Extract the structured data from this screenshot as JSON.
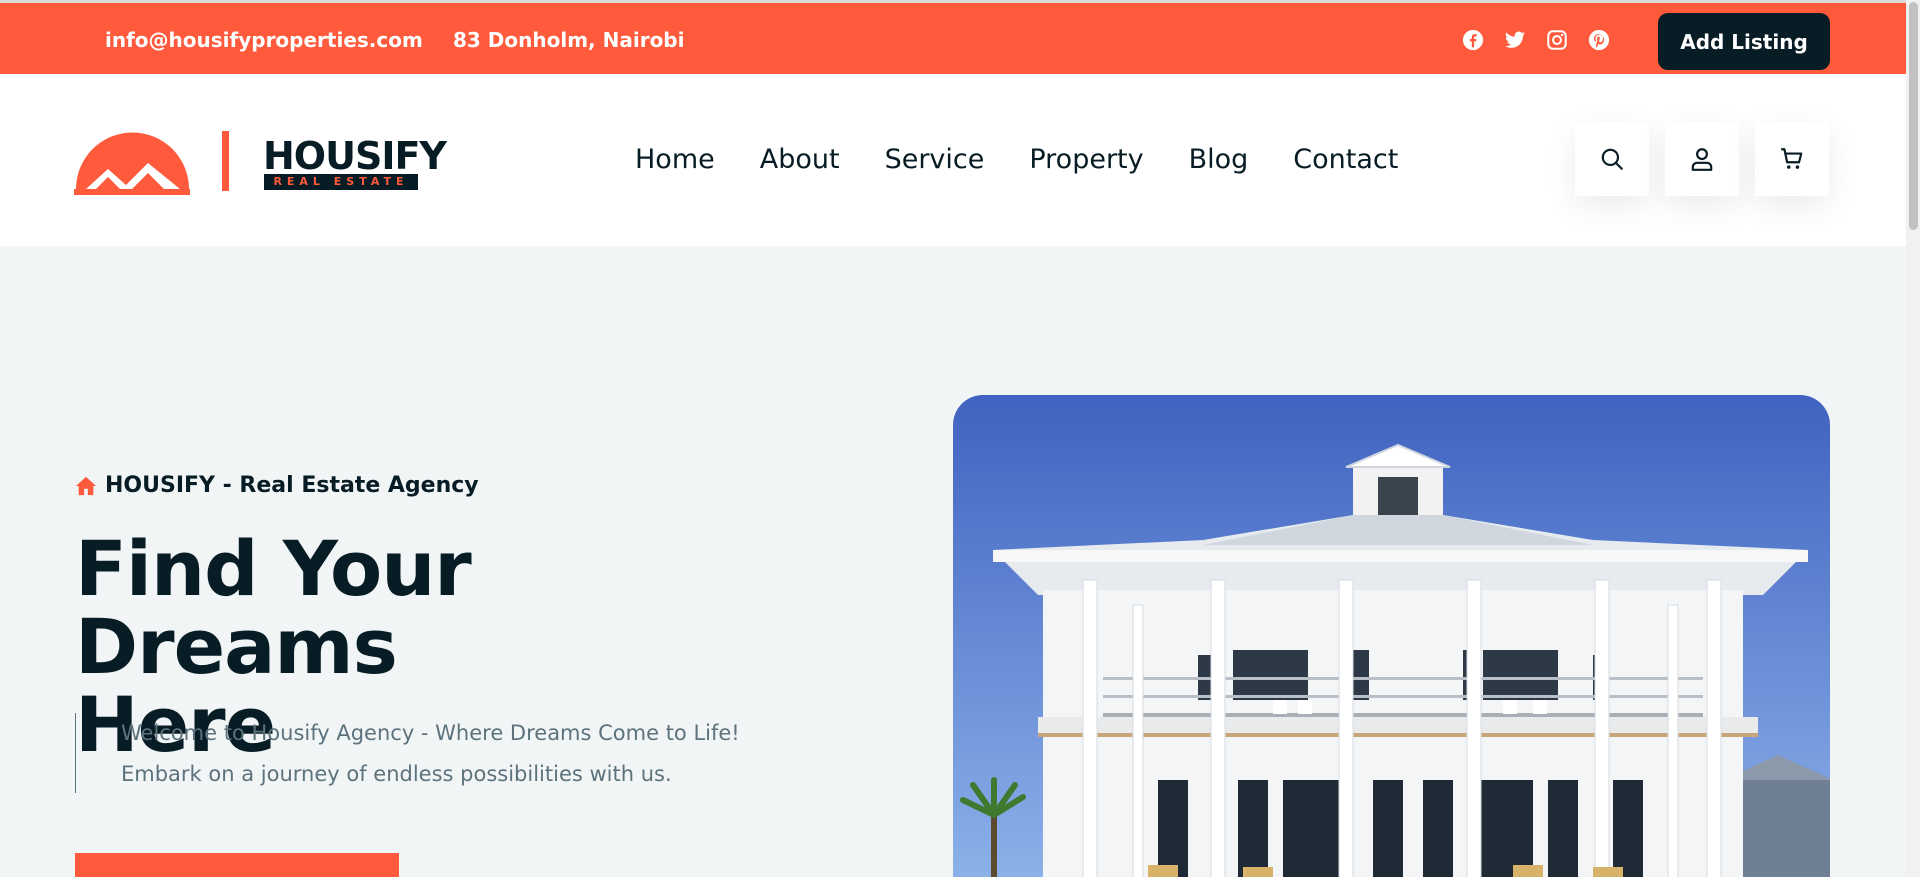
{
  "topbar": {
    "email": "info@housifyproperties.com",
    "address": "83 Donholm, Nairobi",
    "socials": [
      "facebook-icon",
      "twitter-icon",
      "instagram-icon",
      "pinterest-icon"
    ],
    "add_listing_label": "Add Listing"
  },
  "header": {
    "logo_word": "HOUSIFY",
    "logo_sub": "REAL ESTATE",
    "nav": [
      "Home",
      "About",
      "Service",
      "Property",
      "Blog",
      "Contact"
    ],
    "icons": [
      "search-icon",
      "user-icon",
      "cart-icon"
    ]
  },
  "hero": {
    "subtitle": "HOUSIFY - Real Estate Agency",
    "title_line1": "Find Your Dreams",
    "title_line2": "Here",
    "desc_line1": "Welcome to Housify Agency - Where Dreams Come to Life!",
    "desc_line2": "Embark on a journey of endless possibilities with us."
  },
  "colors": {
    "accent": "#ff5a3c",
    "dark": "#071c24",
    "muted": "#5c727d",
    "bg": "#f2f5f6"
  }
}
